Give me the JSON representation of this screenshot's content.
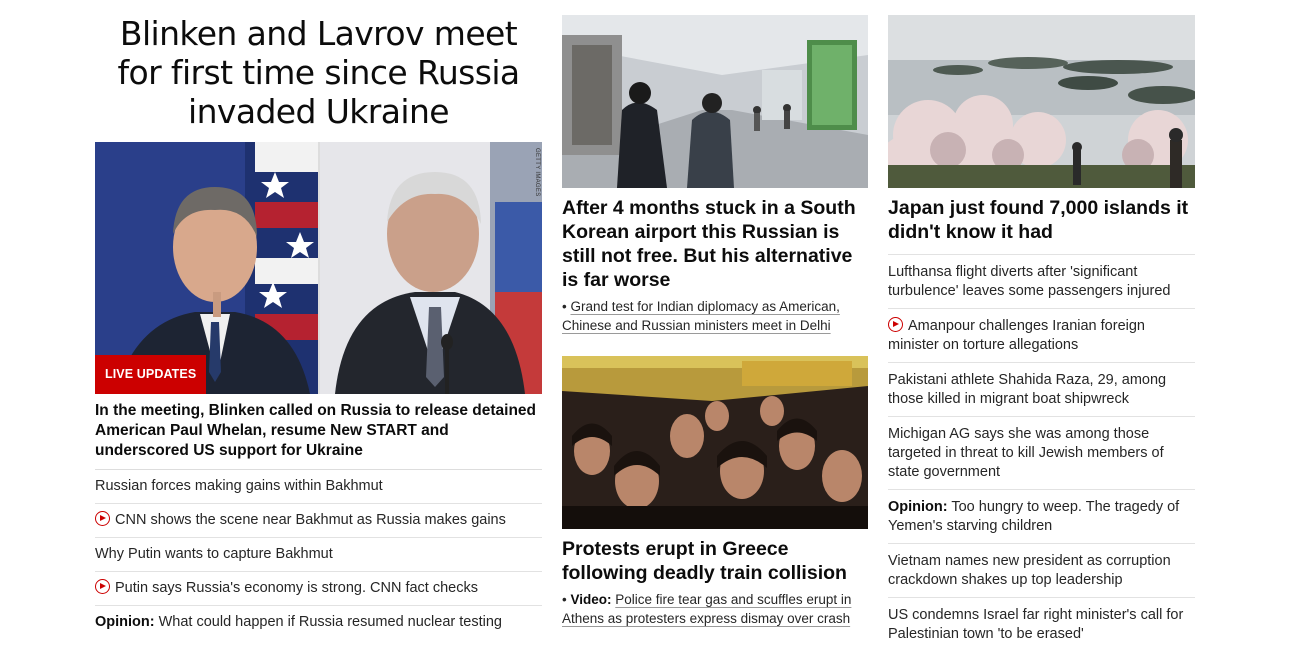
{
  "lead": {
    "headline": "Blinken and Lavrov meet for first time since Russia invaded Ukraine",
    "badge": "LIVE UPDATES",
    "photo_credit": "GETTY IMAGES",
    "summary": "In the meeting, Blinken called on Russia to release detained American Paul Whelan, resume New START and underscored US support for Ukraine",
    "links": [
      {
        "prefix": "",
        "text": "Russian forces making gains within Bakhmut",
        "video": false
      },
      {
        "prefix": "",
        "text": "CNN shows the scene near Bakhmut as Russia makes gains",
        "video": true
      },
      {
        "prefix": "",
        "text": "Why Putin wants to capture Bakhmut",
        "video": false
      },
      {
        "prefix": "",
        "text": "Putin says Russia's economy is strong. CNN fact checks",
        "video": true
      },
      {
        "prefix": "Opinion:",
        "text": " What could happen if Russia resumed nuclear testing",
        "video": false
      }
    ]
  },
  "middle": {
    "card1": {
      "title": "After 4 months stuck in a South Korean airport this Russian is still not free. But his alternative is far worse",
      "bullet": "• ",
      "related": "Grand test for Indian diplomacy as American, Chinese and Russian ministers meet in Delhi"
    },
    "card2": {
      "title": "Protests erupt in Greece following deadly train collision",
      "bullet": "• ",
      "label": "Video:",
      "related": "Police fire tear gas and scuffles erupt in Athens as protesters express dismay over crash"
    }
  },
  "right": {
    "card": {
      "title": "Japan just found 7,000 islands it didn't know it had"
    },
    "links": [
      {
        "prefix": "",
        "text": "Lufthansa flight diverts after 'significant turbulence' leaves some passengers injured",
        "video": false
      },
      {
        "prefix": "",
        "text": "Amanpour challenges Iranian foreign minister on torture allegations",
        "video": true
      },
      {
        "prefix": "",
        "text": "Pakistani athlete Shahida Raza, 29, among those killed in migrant boat shipwreck",
        "video": false
      },
      {
        "prefix": "",
        "text": "Michigan AG says she was among those targeted in threat to kill Jewish members of state government",
        "video": false
      },
      {
        "prefix": "Opinion:",
        "text": " Too hungry to weep. The tragedy of Yemen's starving children",
        "video": false
      },
      {
        "prefix": "",
        "text": "Vietnam names new president as corruption crackdown shakes up top leadership",
        "video": false
      },
      {
        "prefix": "",
        "text": "US condemns Israel far right minister's call for Palestinian town 'to be erased'",
        "video": false
      }
    ]
  },
  "colors": {
    "accent": "#cc0000",
    "text": "#0c0c0c",
    "divider": "#e2e2e2"
  },
  "icons": {
    "video": "play-circle-icon"
  }
}
